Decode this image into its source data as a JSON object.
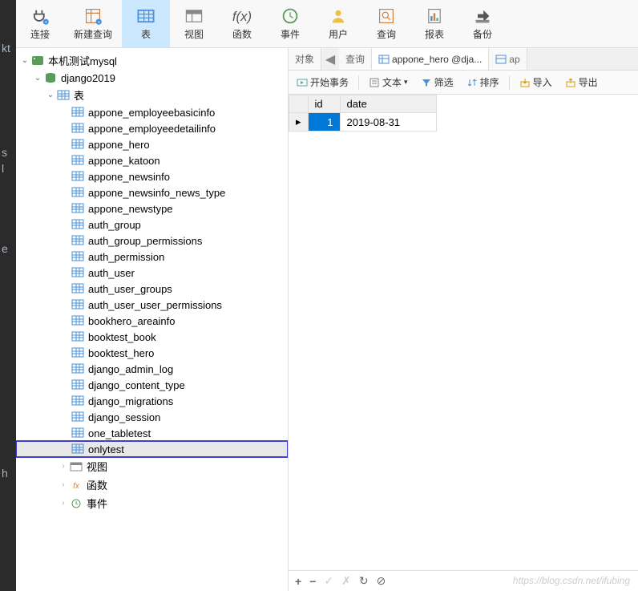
{
  "toolbar": [
    {
      "name": "connect",
      "label": "连接",
      "icon": "plug"
    },
    {
      "name": "new-query",
      "label": "新建查询",
      "icon": "query"
    },
    {
      "name": "table",
      "label": "表",
      "icon": "table",
      "active": true
    },
    {
      "name": "view",
      "label": "视图",
      "icon": "view"
    },
    {
      "name": "function",
      "label": "函数",
      "icon": "fx"
    },
    {
      "name": "event",
      "label": "事件",
      "icon": "clock"
    },
    {
      "name": "user",
      "label": "用户",
      "icon": "user"
    },
    {
      "name": "query2",
      "label": "查询",
      "icon": "search"
    },
    {
      "name": "report",
      "label": "报表",
      "icon": "report"
    },
    {
      "name": "backup",
      "label": "备份",
      "icon": "backup"
    }
  ],
  "tree": {
    "connection": "本机测试mysql",
    "database": "django2019",
    "tables_label": "表",
    "tables": [
      "appone_employeebasicinfo",
      "appone_employeedetailinfo",
      "appone_hero",
      "appone_katoon",
      "appone_newsinfo",
      "appone_newsinfo_news_type",
      "appone_newstype",
      "auth_group",
      "auth_group_permissions",
      "auth_permission",
      "auth_user",
      "auth_user_groups",
      "auth_user_user_permissions",
      "bookhero_areainfo",
      "booktest_book",
      "booktest_hero",
      "django_admin_log",
      "django_content_type",
      "django_migrations",
      "django_session",
      "one_tabletest",
      "onlytest"
    ],
    "sub_items": [
      {
        "label": "视图",
        "icon": "view-s"
      },
      {
        "label": "函数",
        "icon": "fx-s"
      },
      {
        "label": "事件",
        "icon": "clock-s"
      }
    ]
  },
  "tabs": {
    "object": "对象",
    "search": "查询",
    "active": "appone_hero @dja...",
    "next": "ap"
  },
  "actions": {
    "begin_tx": "开始事务",
    "text": "文本",
    "filter": "筛选",
    "sort": "排序",
    "import": "导入",
    "export": "导出"
  },
  "grid": {
    "columns": [
      "id",
      "date"
    ],
    "rows": [
      {
        "id": "1",
        "date": "2019-08-31"
      }
    ]
  },
  "watermark": "https://blog.csdn.net/ifubing"
}
